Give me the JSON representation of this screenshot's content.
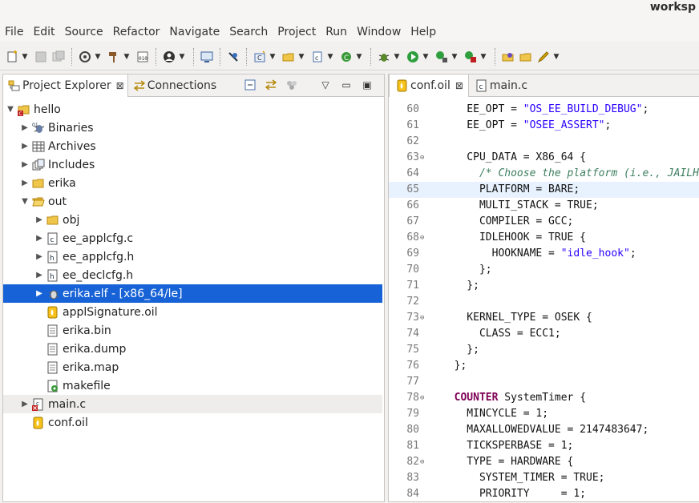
{
  "window": {
    "title": "worksp"
  },
  "menu": [
    "File",
    "Edit",
    "Source",
    "Refactor",
    "Navigate",
    "Search",
    "Project",
    "Run",
    "Window",
    "Help"
  ],
  "left_tabs": {
    "project_explorer": "Project Explorer",
    "connections": "Connections"
  },
  "tree": [
    {
      "label": "hello",
      "indent": 0,
      "arrow": "down",
      "icon": "project-icon"
    },
    {
      "label": "Binaries",
      "indent": 1,
      "arrow": "right",
      "icon": "binaries-icon"
    },
    {
      "label": "Archives",
      "indent": 1,
      "arrow": "right",
      "icon": "archives-icon"
    },
    {
      "label": "Includes",
      "indent": 1,
      "arrow": "right",
      "icon": "includes-icon"
    },
    {
      "label": "erika",
      "indent": 1,
      "arrow": "right",
      "icon": "folder-icon"
    },
    {
      "label": "out",
      "indent": 1,
      "arrow": "down",
      "icon": "folder-open-icon"
    },
    {
      "label": "obj",
      "indent": 2,
      "arrow": "right",
      "icon": "folder-icon"
    },
    {
      "label": "ee_applcfg.c",
      "indent": 2,
      "arrow": "right",
      "icon": "c-file-icon"
    },
    {
      "label": "ee_applcfg.h",
      "indent": 2,
      "arrow": "right",
      "icon": "h-file-icon"
    },
    {
      "label": "ee_declcfg.h",
      "indent": 2,
      "arrow": "right",
      "icon": "h-file-icon"
    },
    {
      "label": "erika.elf - [x86_64/le]",
      "indent": 2,
      "arrow": "right",
      "icon": "binary-bug-icon",
      "selected": true
    },
    {
      "label": "applSignature.oil",
      "indent": 2,
      "arrow": "",
      "icon": "oil-file-icon"
    },
    {
      "label": "erika.bin",
      "indent": 2,
      "arrow": "",
      "icon": "text-file-icon"
    },
    {
      "label": "erika.dump",
      "indent": 2,
      "arrow": "",
      "icon": "text-file-icon"
    },
    {
      "label": "erika.map",
      "indent": 2,
      "arrow": "",
      "icon": "text-file-icon"
    },
    {
      "label": "makefile",
      "indent": 2,
      "arrow": "",
      "icon": "makefile-icon"
    },
    {
      "label": "main.c",
      "indent": 1,
      "arrow": "right",
      "icon": "c-file-error-icon",
      "hover": true
    },
    {
      "label": "conf.oil",
      "indent": 1,
      "arrow": "",
      "icon": "oil-file-icon"
    }
  ],
  "editor_tabs": [
    {
      "label": "conf.oil",
      "active": true,
      "icon": "oil-file-icon"
    },
    {
      "label": "main.c",
      "active": false,
      "icon": "c-file-icon"
    }
  ],
  "code": [
    {
      "n": "60",
      "fold": "",
      "hl": false,
      "parts": [
        [
          "",
          "    EE_OPT = "
        ],
        [
          "str",
          "\"OS_EE_BUILD_DEBUG\""
        ],
        [
          "",
          ";"
        ]
      ]
    },
    {
      "n": "61",
      "fold": "",
      "hl": false,
      "parts": [
        [
          "",
          "    EE_OPT = "
        ],
        [
          "str",
          "\"OSEE_ASSERT\""
        ],
        [
          "",
          ";"
        ]
      ]
    },
    {
      "n": "62",
      "fold": "",
      "hl": false,
      "parts": [
        [
          "",
          ""
        ]
      ]
    },
    {
      "n": "63",
      "fold": "⊖",
      "hl": false,
      "parts": [
        [
          "",
          "    CPU_DATA = X86_64 {"
        ]
      ]
    },
    {
      "n": "64",
      "fold": "",
      "hl": false,
      "parts": [
        [
          "",
          "      "
        ],
        [
          "cmt",
          "/* Choose the platform (i.e., JAILHOUSE"
        ]
      ]
    },
    {
      "n": "65",
      "fold": "",
      "hl": true,
      "parts": [
        [
          "",
          "      PLATFORM = BARE;"
        ]
      ]
    },
    {
      "n": "66",
      "fold": "",
      "hl": false,
      "parts": [
        [
          "",
          "      MULTI_STACK = TRUE;"
        ]
      ]
    },
    {
      "n": "67",
      "fold": "",
      "hl": false,
      "parts": [
        [
          "",
          "      COMPILER = GCC;"
        ]
      ]
    },
    {
      "n": "68",
      "fold": "⊖",
      "hl": false,
      "parts": [
        [
          "",
          "      IDLEHOOK = TRUE {"
        ]
      ]
    },
    {
      "n": "69",
      "fold": "",
      "hl": false,
      "parts": [
        [
          "",
          "        HOOKNAME = "
        ],
        [
          "str",
          "\"idle_hook\""
        ],
        [
          "",
          ";"
        ]
      ]
    },
    {
      "n": "70",
      "fold": "",
      "hl": false,
      "parts": [
        [
          "",
          "      };"
        ]
      ]
    },
    {
      "n": "71",
      "fold": "",
      "hl": false,
      "parts": [
        [
          "",
          "    };"
        ]
      ]
    },
    {
      "n": "72",
      "fold": "",
      "hl": false,
      "parts": [
        [
          "",
          ""
        ]
      ]
    },
    {
      "n": "73",
      "fold": "⊖",
      "hl": false,
      "parts": [
        [
          "",
          "    KERNEL_TYPE = OSEK {"
        ]
      ]
    },
    {
      "n": "74",
      "fold": "",
      "hl": false,
      "parts": [
        [
          "",
          "      CLASS = ECC1;"
        ]
      ]
    },
    {
      "n": "75",
      "fold": "",
      "hl": false,
      "parts": [
        [
          "",
          "    };"
        ]
      ]
    },
    {
      "n": "76",
      "fold": "",
      "hl": false,
      "parts": [
        [
          "",
          "  };"
        ]
      ]
    },
    {
      "n": "77",
      "fold": "",
      "hl": false,
      "parts": [
        [
          "",
          ""
        ]
      ]
    },
    {
      "n": "78",
      "fold": "⊖",
      "hl": false,
      "parts": [
        [
          "",
          "  "
        ],
        [
          "kw",
          "COUNTER"
        ],
        [
          "",
          " SystemTimer {"
        ]
      ]
    },
    {
      "n": "79",
      "fold": "",
      "hl": false,
      "parts": [
        [
          "",
          "    MINCYCLE = 1;"
        ]
      ]
    },
    {
      "n": "80",
      "fold": "",
      "hl": false,
      "parts": [
        [
          "",
          "    MAXALLOWEDVALUE = 2147483647;"
        ]
      ]
    },
    {
      "n": "81",
      "fold": "",
      "hl": false,
      "parts": [
        [
          "",
          "    TICKSPERBASE = 1;"
        ]
      ]
    },
    {
      "n": "82",
      "fold": "⊖",
      "hl": false,
      "parts": [
        [
          "",
          "    TYPE = HARDWARE {"
        ]
      ]
    },
    {
      "n": "83",
      "fold": "",
      "hl": false,
      "parts": [
        [
          "",
          "      SYSTEM_TIMER = TRUE;"
        ]
      ]
    },
    {
      "n": "84",
      "fold": "",
      "hl": false,
      "parts": [
        [
          "",
          "      PRIORITY     = 1;"
        ]
      ]
    }
  ]
}
